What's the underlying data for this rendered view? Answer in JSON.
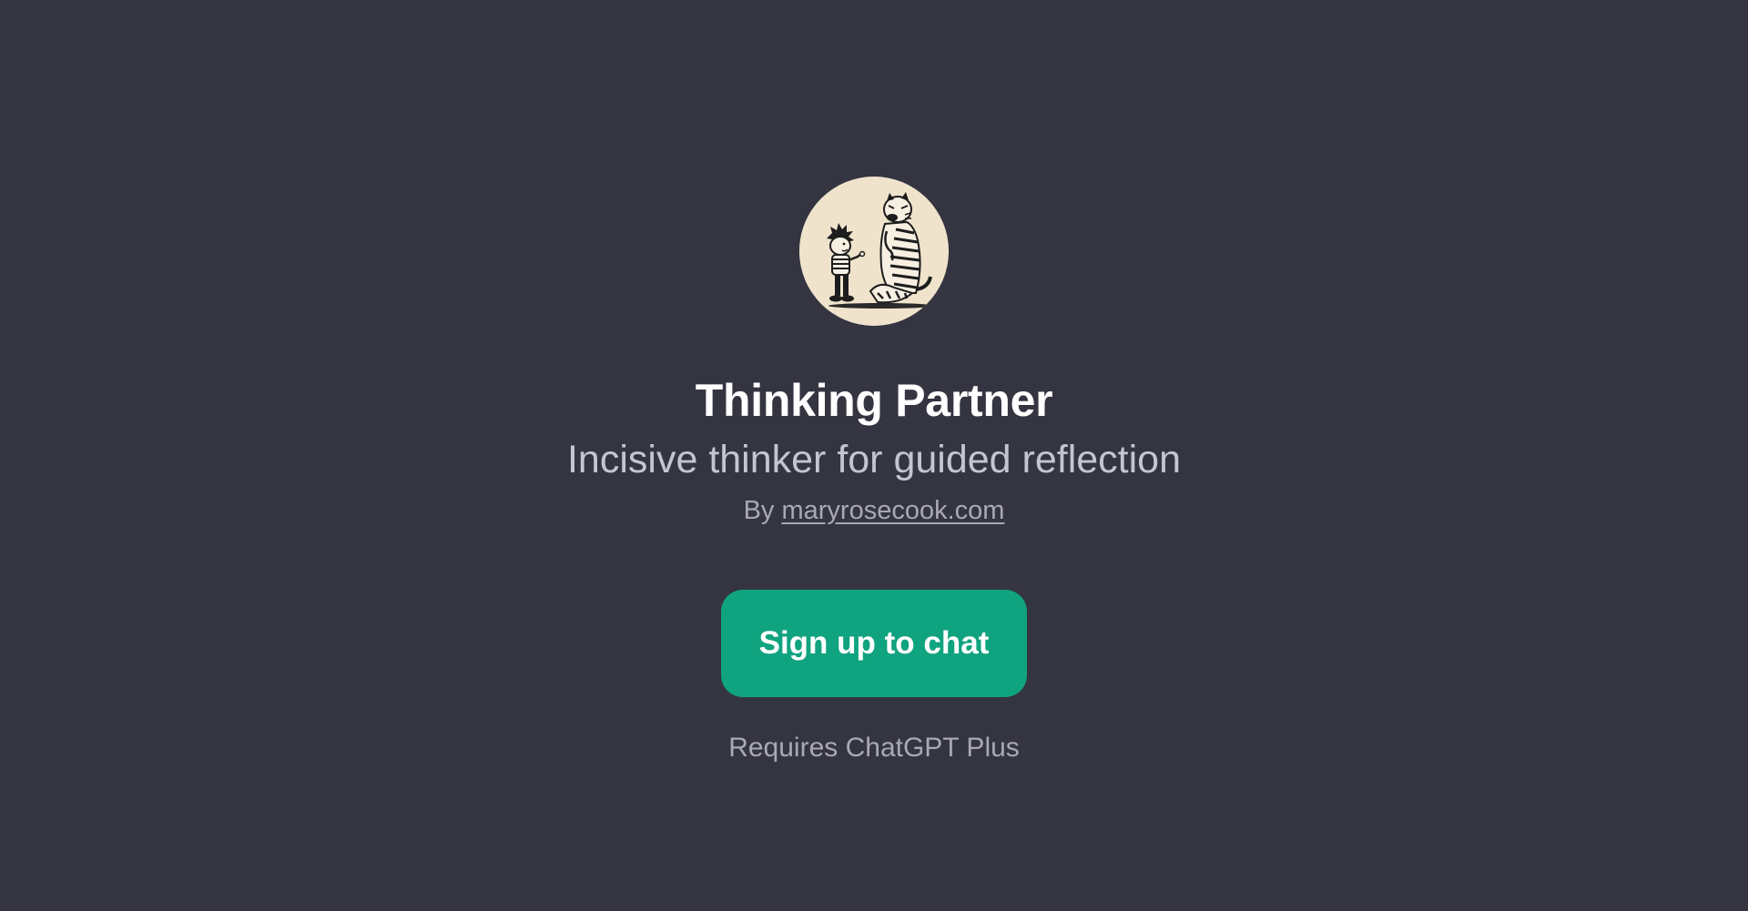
{
  "gpt": {
    "avatar_icon": "calvin-and-hobbes-illustration-icon",
    "name": "Thinking Partner",
    "description": "Incisive thinker for guided reflection",
    "by_prefix": "By",
    "author": "maryrosecook.com"
  },
  "cta": {
    "label": "Sign up to chat"
  },
  "requirement": "Requires ChatGPT Plus",
  "colors": {
    "background": "#343541",
    "accent": "#10a37f",
    "avatar_bg": "#efe3cc"
  }
}
